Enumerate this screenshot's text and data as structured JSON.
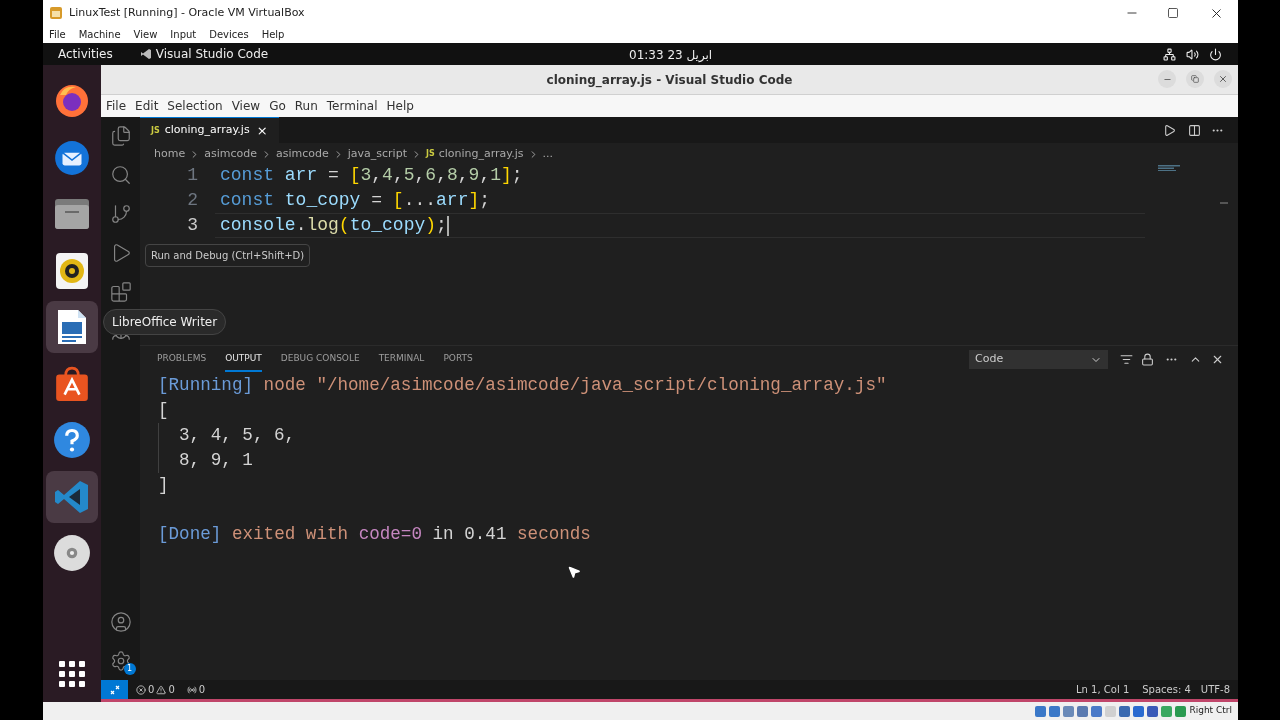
{
  "vbox": {
    "title": "LinuxTest [Running] - Oracle VM VirtualBox",
    "menu": [
      "File",
      "Machine",
      "View",
      "Input",
      "Devices",
      "Help"
    ],
    "host_key": "Right Ctrl"
  },
  "topbar": {
    "activities": "Activities",
    "app": "Visual Studio Code",
    "clock": "01:33  23 ابریل"
  },
  "dock": {
    "items": [
      {
        "kind": "firefox",
        "highlighted": false
      },
      {
        "kind": "thunderbird",
        "highlighted": false
      },
      {
        "kind": "files",
        "highlighted": false
      },
      {
        "kind": "rhythmbox",
        "highlighted": false
      },
      {
        "kind": "writer",
        "highlighted": true
      },
      {
        "kind": "appcenter",
        "highlighted": false
      },
      {
        "kind": "help",
        "highlighted": false
      },
      {
        "kind": "vscode",
        "highlighted": true
      },
      {
        "kind": "disc",
        "highlighted": false
      }
    ],
    "tooltip": "LibreOffice Writer"
  },
  "vscode": {
    "title": "cloning_array.js - Visual Studio Code",
    "menu": [
      "File",
      "Edit",
      "Selection",
      "View",
      "Go",
      "Run",
      "Terminal",
      "Help"
    ],
    "activity_tooltip": "Run and Debug (Ctrl+Shift+D)",
    "settings_badge": "1",
    "tab": {
      "icon": "JS",
      "label": "cloning_array.js",
      "close": "×"
    },
    "breadcrumb_icon": "JS",
    "breadcrumb": [
      "home",
      "asimcode",
      "asimcode",
      "java_script",
      "cloning_array.js",
      "..."
    ],
    "code": [
      {
        "number": "1",
        "current": false,
        "tokens": [
          {
            "kind": "keyword",
            "text": "const "
          },
          {
            "kind": "variable",
            "text": "arr"
          },
          {
            "kind": "plain",
            "text": " = "
          },
          {
            "kind": "bracket",
            "text": "["
          },
          {
            "kind": "number",
            "text": "3"
          },
          {
            "kind": "plain",
            "text": ","
          },
          {
            "kind": "number",
            "text": "4"
          },
          {
            "kind": "plain",
            "text": ","
          },
          {
            "kind": "number",
            "text": "5"
          },
          {
            "kind": "plain",
            "text": ","
          },
          {
            "kind": "number",
            "text": "6"
          },
          {
            "kind": "plain",
            "text": ","
          },
          {
            "kind": "number",
            "text": "8"
          },
          {
            "kind": "plain",
            "text": ","
          },
          {
            "kind": "number",
            "text": "9"
          },
          {
            "kind": "plain",
            "text": ","
          },
          {
            "kind": "number",
            "text": "1"
          },
          {
            "kind": "bracket",
            "text": "]"
          },
          {
            "kind": "plain",
            "text": ";"
          }
        ]
      },
      {
        "number": "2",
        "current": false,
        "tokens": [
          {
            "kind": "keyword",
            "text": "const "
          },
          {
            "kind": "variable",
            "text": "to_copy"
          },
          {
            "kind": "plain",
            "text": " = "
          },
          {
            "kind": "bracket",
            "text": "["
          },
          {
            "kind": "plain",
            "text": "..."
          },
          {
            "kind": "variable",
            "text": "arr"
          },
          {
            "kind": "bracket",
            "text": "]"
          },
          {
            "kind": "plain",
            "text": ";"
          }
        ]
      },
      {
        "number": "3",
        "current": true,
        "tokens": [
          {
            "kind": "variable",
            "text": "console"
          },
          {
            "kind": "plain",
            "text": "."
          },
          {
            "kind": "function",
            "text": "log"
          },
          {
            "kind": "bracket",
            "text": "("
          },
          {
            "kind": "variable",
            "text": "to_copy"
          },
          {
            "kind": "bracket",
            "text": ")"
          },
          {
            "kind": "plain",
            "text": ";"
          }
        ]
      }
    ],
    "panel_tabs": [
      {
        "label": "PROBLEMS",
        "selected": false
      },
      {
        "label": "OUTPUT",
        "selected": true
      },
      {
        "label": "DEBUG CONSOLE",
        "selected": false
      },
      {
        "label": "TERMINAL",
        "selected": false
      },
      {
        "label": "PORTS",
        "selected": false
      }
    ],
    "output_channel": "Code",
    "output": {
      "header": [
        {
          "kind": "tag",
          "text": "[Running]"
        },
        {
          "kind": "string",
          "text": " node \"/home/asimcode/asimcode/java_script/cloning_array.js\""
        }
      ],
      "array": {
        "open": "[",
        "items": [
          "3, 4, 5, 6,",
          "8, 9, 1"
        ],
        "close": "]"
      },
      "footer": [
        {
          "kind": "tag",
          "text": "[Done]"
        },
        {
          "kind": "string",
          "text": " exited with "
        },
        {
          "kind": "code",
          "text": "code=0"
        },
        {
          "kind": "plain",
          "text": " in 0.41 "
        },
        {
          "kind": "string",
          "text": "seconds"
        }
      ]
    },
    "status": {
      "errors": "0",
      "warnings": "0",
      "ports": "0",
      "position": "Ln 1, Col 1",
      "spaces": "Spaces: 4",
      "encoding": "UTF-8"
    }
  }
}
